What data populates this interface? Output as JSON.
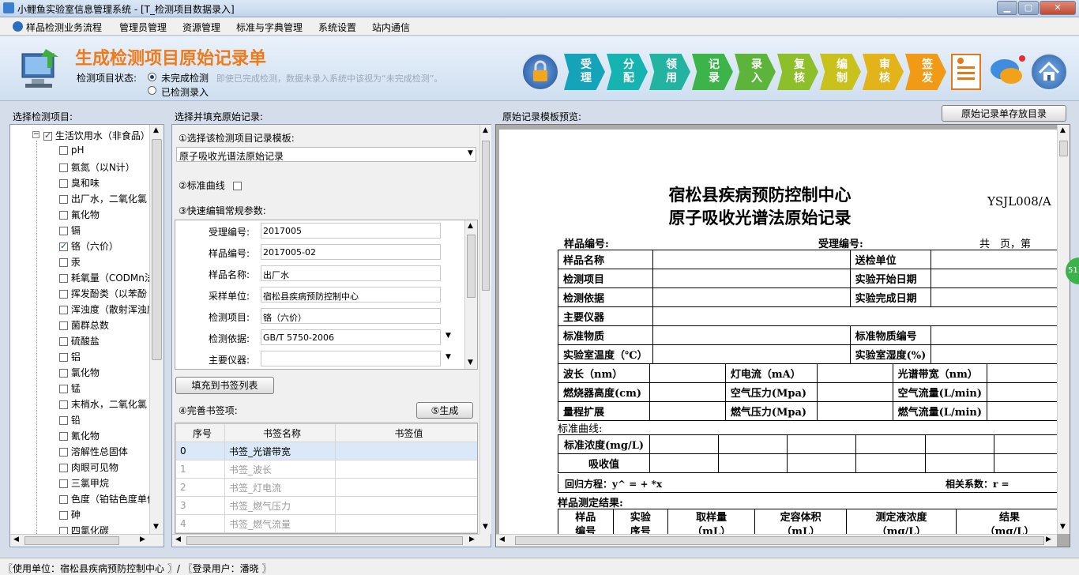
{
  "window": {
    "title": "小鲤鱼实验室信息管理系统 - [T_检测项目数据录入]"
  },
  "menu": [
    "样品检测业务流程",
    "管理员管理",
    "资源管理",
    "标准与字典管理",
    "系统设置",
    "站内通信"
  ],
  "header": {
    "title": "生成检测项目原始记录单",
    "status_label": "检测项目状态:",
    "opt_incomplete": "未完成检测",
    "hint": "即使已完成检测，数据未录入系统中该视为“未完成检测”。",
    "opt_done": "已检测录入"
  },
  "workflow": [
    {
      "l1": "受",
      "l2": "理",
      "color": "#14a3b8"
    },
    {
      "l1": "分",
      "l2": "配",
      "color": "#16b4b0"
    },
    {
      "l1": "领",
      "l2": "用",
      "color": "#22b4a0"
    },
    {
      "l1": "记",
      "l2": "录",
      "color": "#3cb44a"
    },
    {
      "l1": "录",
      "l2": "入",
      "color": "#5cb43a"
    },
    {
      "l1": "复",
      "l2": "核",
      "color": "#8cbf2a"
    },
    {
      "l1": "编",
      "l2": "制",
      "color": "#c9c21c"
    },
    {
      "l1": "审",
      "l2": "核",
      "color": "#e3b31a"
    },
    {
      "l1": "签",
      "l2": "发",
      "color": "#f09a16"
    }
  ],
  "left": {
    "label": "选择检测项目:",
    "root": "生活饮用水（非食品）",
    "items": [
      {
        "t": "pH",
        "c": false
      },
      {
        "t": "氨氮（以N计）",
        "c": false
      },
      {
        "t": "臭和味",
        "c": false
      },
      {
        "t": "出厂水，二氧化氯",
        "c": false
      },
      {
        "t": "氟化物",
        "c": false
      },
      {
        "t": "镉",
        "c": false
      },
      {
        "t": "铬（六价）",
        "c": true
      },
      {
        "t": "汞",
        "c": false
      },
      {
        "t": "耗氧量（CODMn法,",
        "c": false
      },
      {
        "t": "挥发酚类（以苯酚",
        "c": false
      },
      {
        "t": "浑浊度（散射浑浊度",
        "c": false
      },
      {
        "t": "菌群总数",
        "c": false
      },
      {
        "t": "硫酸盐",
        "c": false
      },
      {
        "t": "铝",
        "c": false
      },
      {
        "t": "氯化物",
        "c": false
      },
      {
        "t": "锰",
        "c": false
      },
      {
        "t": "末梢水，二氧化氯",
        "c": false
      },
      {
        "t": "铅",
        "c": false
      },
      {
        "t": "氰化物",
        "c": false
      },
      {
        "t": "溶解性总固体",
        "c": false
      },
      {
        "t": "肉眼可见物",
        "c": false
      },
      {
        "t": "三氯甲烷",
        "c": false
      },
      {
        "t": "色度（铂钴色度单位",
        "c": false
      },
      {
        "t": "砷",
        "c": false
      },
      {
        "t": "四氯化碳",
        "c": false
      }
    ]
  },
  "mid": {
    "label": "选择并填充原始记录:",
    "step1": "①选择该检测项目记录模板:",
    "template": "原子吸收光谱法原始记录",
    "step2": "②标准曲线",
    "step3": "③快速编辑常规参数:",
    "params": [
      {
        "k": "受理编号:",
        "v": "2017005"
      },
      {
        "k": "样品编号:",
        "v": "2017005-02"
      },
      {
        "k": "样品名称:",
        "v": "出厂水"
      },
      {
        "k": "采样单位:",
        "v": "宿松县疾病预防控制中心"
      },
      {
        "k": "检测项目:",
        "v": "铬（六价）"
      },
      {
        "k": "检测依据:",
        "v": "GB/T 5750-2006"
      },
      {
        "k": "主要仪器:",
        "v": ""
      }
    ],
    "fill_btn": "填充到书签列表",
    "step4": "④完善书签项:",
    "gen_btn": "⑤生成",
    "grid_headers": [
      "序号",
      "书签名称",
      "书签值"
    ],
    "grid_rows": [
      {
        "n": "0",
        "name": "书签_光谱带宽",
        "v": ""
      },
      {
        "n": "1",
        "name": "书签_波长",
        "v": ""
      },
      {
        "n": "2",
        "name": "书签_灯电流",
        "v": ""
      },
      {
        "n": "3",
        "name": "书签_燃气压力",
        "v": ""
      },
      {
        "n": "4",
        "name": "书签_燃气流量",
        "v": ""
      }
    ]
  },
  "right": {
    "label": "原始记录模板预览:",
    "store_btn": "原始记录单存放目录",
    "doc_title1": "宿松县疾病预防控制中心",
    "doc_title2": "原子吸收光谱法原始记录",
    "doc_code": "YSJL008/A",
    "row_a_left": "样品编号:",
    "row_a_mid": "受理编号:",
    "row_a_right": "共　页，第",
    "rows": [
      [
        "样品名称",
        "送检单位"
      ],
      [
        "检测项目",
        "实验开始日期"
      ],
      [
        "检测依据",
        "实验完成日期"
      ],
      [
        "主要仪器"
      ],
      [
        "标准物质",
        "标准物质编号"
      ],
      [
        "实验室温度（℃）",
        "实验室湿度(%)"
      ]
    ],
    "rows3": [
      [
        "波长（nm）",
        "灯电流（mA）",
        "光谱带宽（nm）"
      ],
      [
        "燃烧器高度(cm)",
        "空气压力(Mpa)",
        "空气流量(L/min)"
      ],
      [
        "量程扩展",
        "燃气压力(Mpa)",
        "燃气流量(L/min)"
      ]
    ],
    "curve_label": "标准曲线:",
    "curve_rows": [
      "标准浓度(mg/L)",
      "吸收值"
    ],
    "regression": "回归方程：y^ = +  *x",
    "corr": "相关系数：r =",
    "result_label": "样品测定结果:",
    "result_headers": [
      {
        "a": "样品",
        "b": "编号"
      },
      {
        "a": "实验",
        "b": "序号"
      },
      {
        "a": "取样量",
        "b": "（mL）"
      },
      {
        "a": "定容体积",
        "b": "（mL）"
      },
      {
        "a": "测定液浓度",
        "b": "（mg/L）"
      },
      {
        "a": "结果",
        "b": "（mg/L）"
      }
    ],
    "side_badge": "51"
  },
  "status": {
    "text": "〖使用单位：宿松县疾病预防控制中心 〗/ 〖登录用户：潘晓 〗"
  }
}
